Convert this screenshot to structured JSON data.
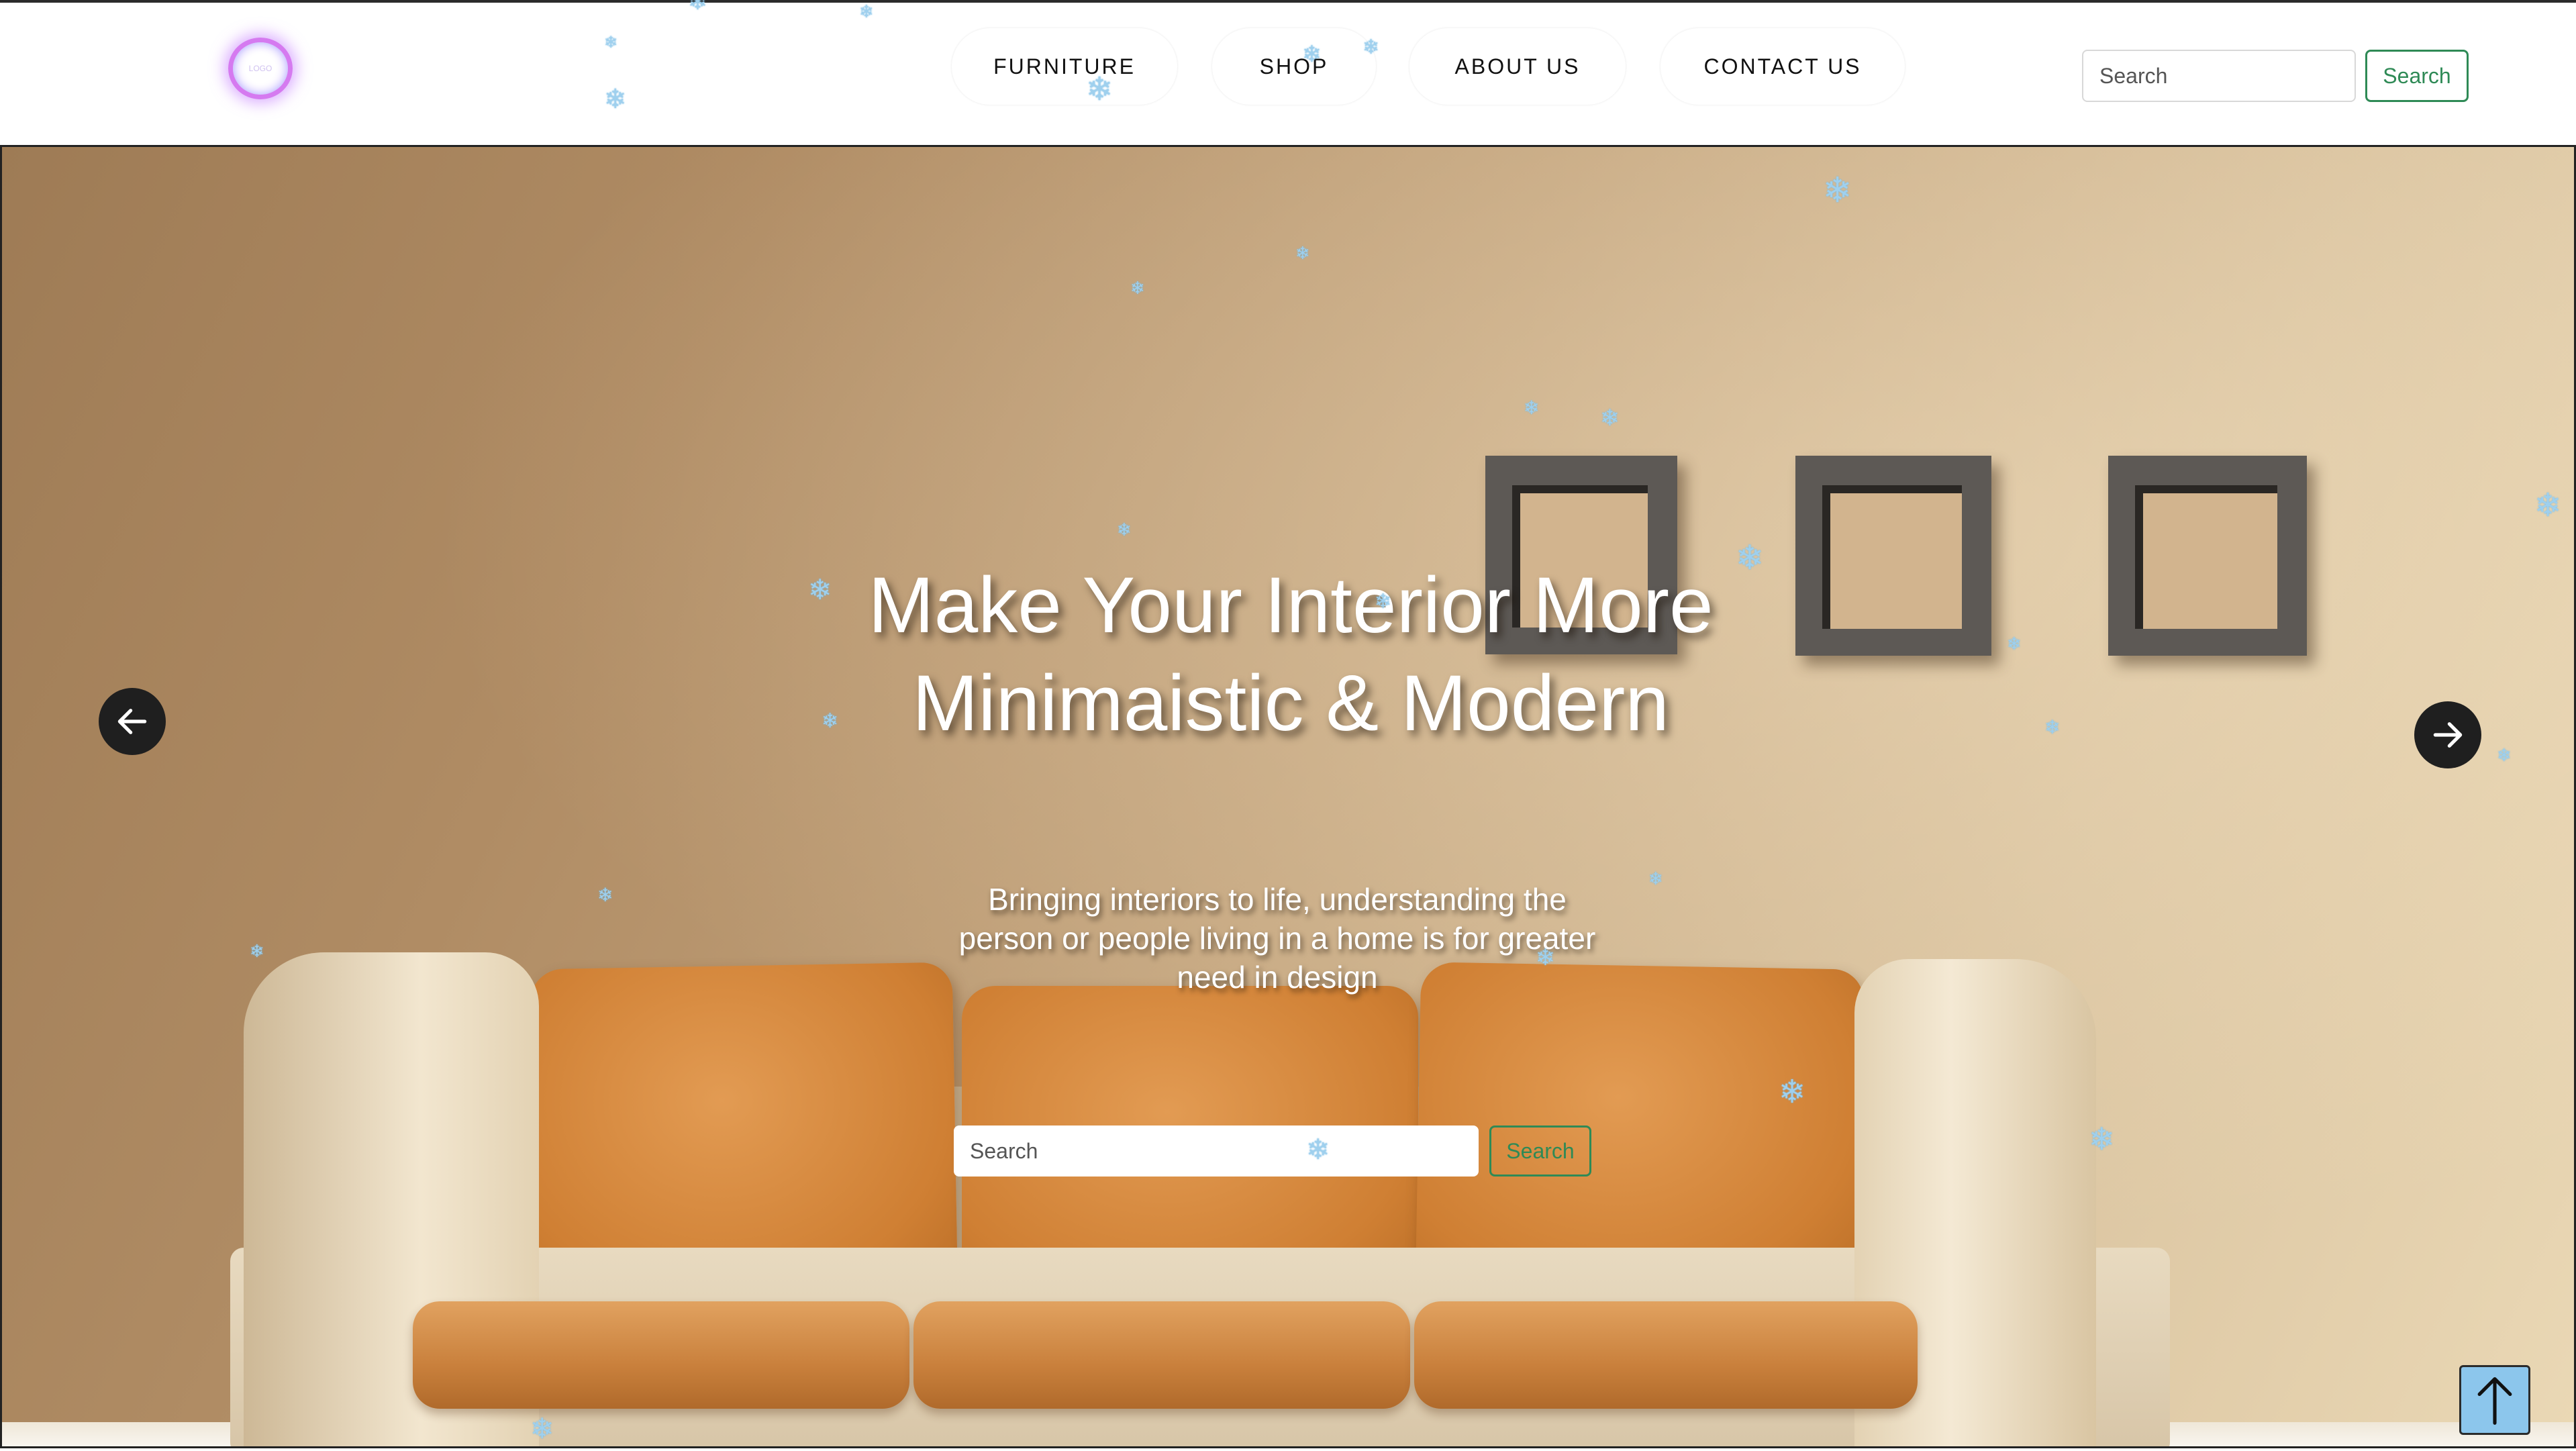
{
  "header": {
    "logo_text": "LOGO",
    "nav": [
      {
        "label": "FURNITURE"
      },
      {
        "label": "SHOP"
      },
      {
        "label": "ABOUT US"
      },
      {
        "label": "CONTACT US"
      }
    ],
    "search": {
      "placeholder": "Search",
      "button_label": "Search"
    }
  },
  "hero": {
    "title_line1": "Make Your Interior More",
    "title_line2": "Minimaistic & Modern",
    "subtitle_line1": "Bringing interiors to life, understanding the",
    "subtitle_line2": "person or people living in a home is for greater",
    "subtitle_line3": "need in design",
    "search": {
      "placeholder": "Search",
      "button_label": "Search"
    },
    "prev_icon": "arrow-left-icon",
    "next_icon": "arrow-right-icon"
  },
  "scroll_to_top": {
    "icon": "arrow-up-icon"
  },
  "colors": {
    "accent_green": "#2f8a56",
    "arrow_bg": "#1f1f1f",
    "scroll_top_bg": "#8cc6ec",
    "snowflake": "#9fd0ee",
    "logo_glow": "#d57af0"
  },
  "decoration": {
    "snowflake_glyph": "❄"
  }
}
